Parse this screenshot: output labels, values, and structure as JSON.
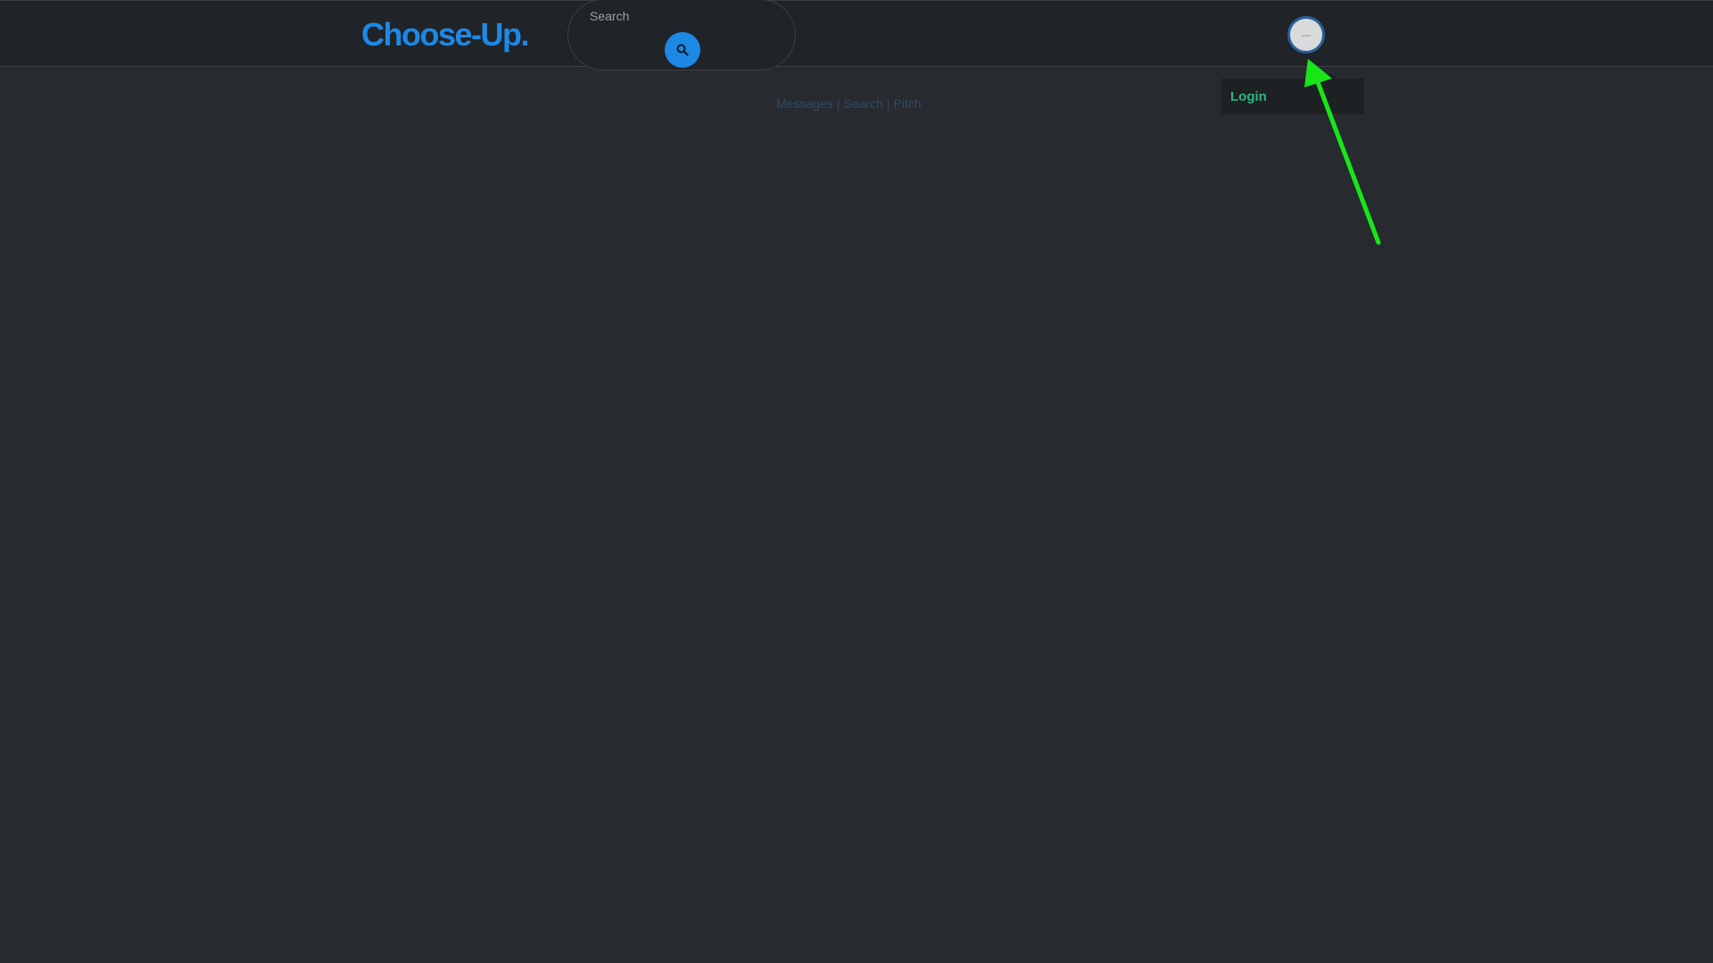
{
  "header": {
    "brand": "Choose-Up",
    "brand_dot": ".",
    "search_placeholder": "Search",
    "search_button_icon": "search-icon",
    "avatar_icon": "user-avatar"
  },
  "dropdown": {
    "login_label": "Login"
  },
  "subnav": {
    "items": [
      "Messages",
      "Search",
      "Pitch"
    ],
    "separator": "|"
  },
  "colors": {
    "background": "#272b30",
    "header": "#202327",
    "brand": "#1e88e5",
    "login": "#2fb380",
    "annotation_arrow": "#19e619"
  }
}
